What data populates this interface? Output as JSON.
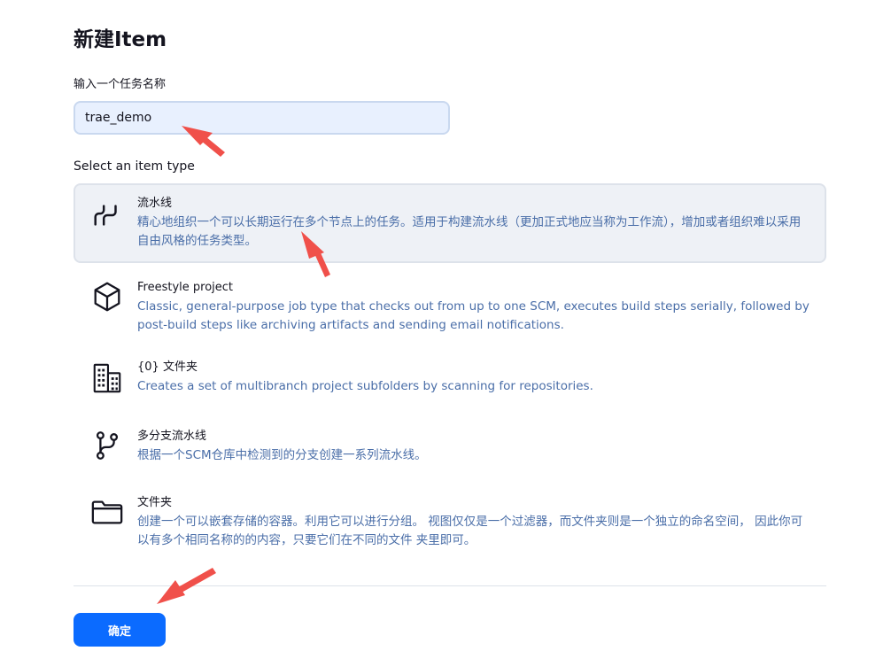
{
  "page": {
    "title": "新建Item"
  },
  "name_field": {
    "label": "输入一个任务名称",
    "value": "trae_demo"
  },
  "item_type": {
    "label": "Select an item type",
    "options": [
      {
        "name": "流水线",
        "description": "精心地组织一个可以长期运行在多个节点上的任务。适用于构建流水线（更加正式地应当称为工作流），增加或者组织难以采用自由风格的任务类型。",
        "icon": "pipeline-icon",
        "selected": true
      },
      {
        "name": "Freestyle project",
        "description": "Classic, general-purpose job type that checks out from up to one SCM, executes build steps serially, followed by post-build steps like archiving artifacts and sending email notifications.",
        "icon": "cube-icon",
        "selected": false
      },
      {
        "name": "{0} 文件夹",
        "description": "Creates a set of multibranch project subfolders by scanning for repositories.",
        "icon": "building-icon",
        "selected": false
      },
      {
        "name": "多分支流水线",
        "description": "根据一个SCM仓库中检测到的分支创建一系列流水线。",
        "icon": "branch-icon",
        "selected": false
      },
      {
        "name": "文件夹",
        "description": "创建一个可以嵌套存储的容器。利用它可以进行分组。 视图仅仅是一个过滤器，而文件夹则是一个独立的命名空间， 因此你可以有多个相同名称的的内容，只要它们在不同的文件 夹里即可。",
        "icon": "folder-icon",
        "selected": false
      }
    ]
  },
  "footer": {
    "ok_label": "确定"
  },
  "colors": {
    "accent": "#0b6bff",
    "description_text": "#4a6ea8",
    "selected_background": "#eef1f6",
    "annotation_arrow": "#f0504a"
  }
}
